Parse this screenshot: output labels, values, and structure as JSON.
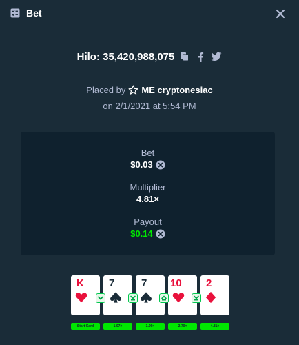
{
  "header": {
    "title": "Bet",
    "icon": "bet-slip-icon",
    "close_icon": "close-icon"
  },
  "bet": {
    "game_title": "Hilo: 35,420,988,075",
    "icons": [
      "copy-icon",
      "facebook-icon",
      "twitter-icon"
    ],
    "placed_by_prefix": "Placed by",
    "user_badge_icon": "star-icon",
    "username": "ME cryptonesiac",
    "date": "on 2/1/2021 at 5:54 PM"
  },
  "stats": {
    "bet_label": "Bet",
    "bet_value": "$0.03",
    "multiplier_label": "Multiplier",
    "multiplier_value": "4.81×",
    "payout_label": "Payout",
    "payout_value": "$0.14"
  },
  "cards": [
    {
      "rank": "K",
      "suit": "hearts",
      "color": "red",
      "label": "Start Card"
    },
    {
      "rank": "7",
      "suit": "spades",
      "color": "black",
      "label": "1.07×"
    },
    {
      "rank": "7",
      "suit": "spades",
      "color": "black",
      "label": "1.99×"
    },
    {
      "rank": "10",
      "suit": "hearts",
      "color": "red",
      "label": "2.70×"
    },
    {
      "rank": "2",
      "suit": "diamonds",
      "color": "red",
      "label": "4.81×"
    }
  ],
  "guesses": [
    "lower",
    "lower",
    "higher",
    "lower"
  ],
  "colors": {
    "background": "#1a2c38",
    "panel": "#0f212e",
    "muted_text": "#b1bad3",
    "win_green": "#00e701",
    "card_red": "#e9113c"
  }
}
